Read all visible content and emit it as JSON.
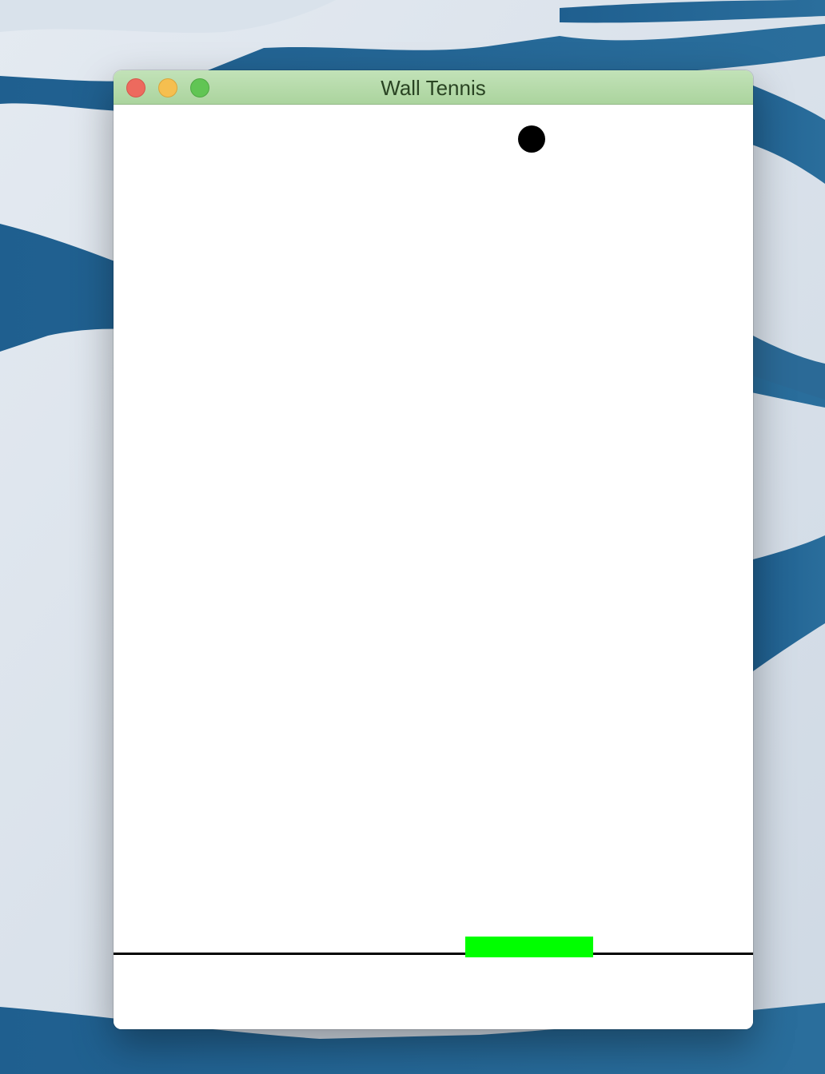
{
  "window": {
    "title": "Wall Tennis",
    "titlebar_color": "#b6dca9"
  },
  "buttons": {
    "close": "close-icon",
    "minimize": "minimize-icon",
    "zoom": "zoom-icon"
  },
  "game": {
    "background_color": "#ffffff",
    "ball_color": "#000000",
    "paddle_color": "#00ff00",
    "floor_line_color": "#000000"
  }
}
